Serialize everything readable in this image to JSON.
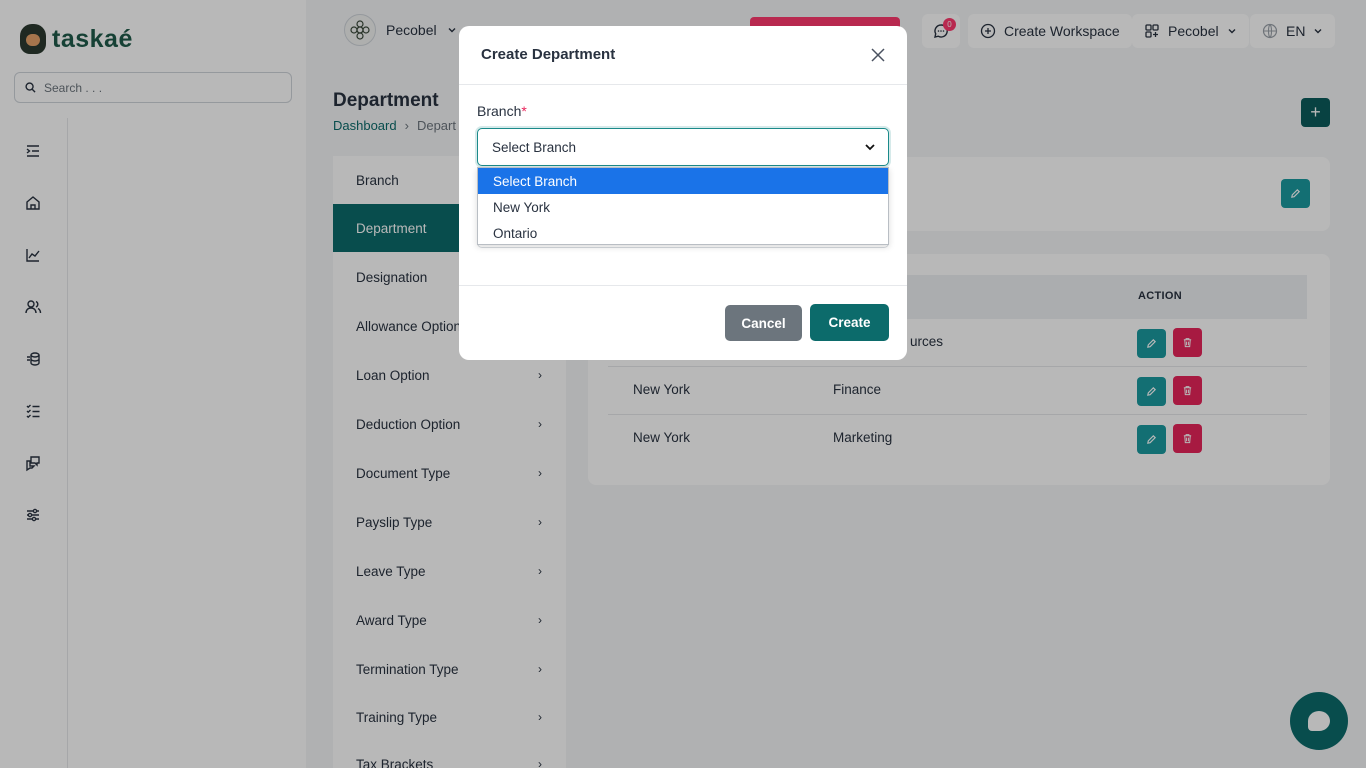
{
  "app": {
    "logo_text": "taskaé",
    "search_placeholder": "Search . . ."
  },
  "topbar": {
    "workspace_name": "Pecobel",
    "notifications_count": "0",
    "create_workspace_label": "Create Workspace",
    "user_name": "Pecobel",
    "language": "EN"
  },
  "page": {
    "title": "Department",
    "breadcrumb": [
      "Dashboard",
      "Depart"
    ]
  },
  "settings_nav": [
    {
      "label": "Branch",
      "active": false,
      "chevron": false
    },
    {
      "label": "Department",
      "active": true,
      "chevron": false
    },
    {
      "label": "Designation",
      "active": false,
      "chevron": false
    },
    {
      "label": "Allowance Option",
      "active": false,
      "chevron": false
    },
    {
      "label": "Loan Option",
      "active": false,
      "chevron": true
    },
    {
      "label": "Deduction Option",
      "active": false,
      "chevron": true
    },
    {
      "label": "Document Type",
      "active": false,
      "chevron": true
    },
    {
      "label": "Payslip Type",
      "active": false,
      "chevron": true
    },
    {
      "label": "Leave Type",
      "active": false,
      "chevron": true
    },
    {
      "label": "Award Type",
      "active": false,
      "chevron": true
    },
    {
      "label": "Termination Type",
      "active": false,
      "chevron": true
    },
    {
      "label": "Training Type",
      "active": false,
      "chevron": true
    },
    {
      "label": "Tax Brackets",
      "active": false,
      "chevron": true
    }
  ],
  "table": {
    "action_header": "ACTION",
    "rows": [
      {
        "branch": "",
        "department": "urces"
      },
      {
        "branch": "New York",
        "department": "Finance"
      },
      {
        "branch": "New York",
        "department": "Marketing"
      }
    ]
  },
  "modal": {
    "title": "Create Department",
    "branch_label": "Branch",
    "required_mark": "*",
    "select_value": "Select Branch",
    "options": [
      "Select Branch",
      "New York",
      "Ontario"
    ],
    "cancel_label": "Cancel",
    "create_label": "Create"
  },
  "icons": {
    "rail": [
      "menu-collapse-icon",
      "home-icon",
      "chart-icon",
      "users-icon",
      "finance-icon",
      "tasks-icon",
      "messages-icon",
      "settings-sliders-icon"
    ]
  },
  "colors": {
    "primary": "#0c6b6b",
    "accent_teal": "#1b9aa0",
    "danger": "#e8245a",
    "option_highlight": "#1a73e8"
  }
}
